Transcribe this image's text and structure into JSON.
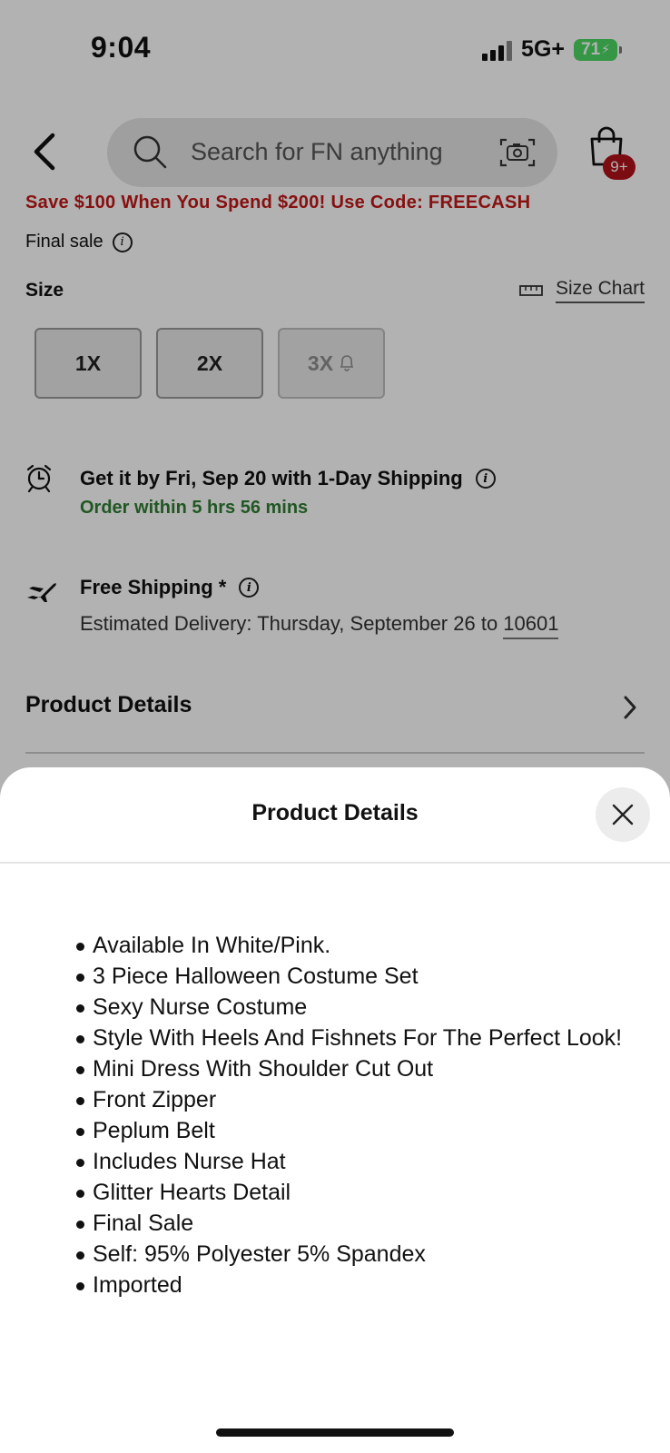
{
  "status_bar": {
    "time": "9:04",
    "network": "5G+",
    "battery": "71"
  },
  "header": {
    "search_placeholder": "Search for FN anything",
    "cart_badge": "9+"
  },
  "product": {
    "promo": "Save $100 When You Spend $200! Use Code: FREECASH",
    "final_sale_label": "Final sale",
    "size_label": "Size",
    "size_chart_label": "Size Chart",
    "sizes": [
      {
        "label": "1X",
        "available": true
      },
      {
        "label": "2X",
        "available": true
      },
      {
        "label": "3X",
        "available": false
      }
    ]
  },
  "shipping": {
    "express_title": "Get it by Fri, Sep 20 with 1-Day Shipping",
    "express_sub": "Order within 5 hrs 56 mins",
    "free_title": "Free Shipping *",
    "free_sub_prefix": "Estimated Delivery: Thursday, September 26 to ",
    "zip": "10601"
  },
  "details_row_label": "Product Details",
  "sheet": {
    "title": "Product Details",
    "bullets": [
      "Available In White/Pink.",
      "3 Piece Halloween Costume Set",
      "Sexy Nurse Costume",
      "Style With Heels And Fishnets For The Perfect Look!",
      "Mini Dress With Shoulder Cut Out",
      "Front Zipper",
      "Peplum Belt",
      "Includes Nurse Hat",
      "Glitter Hearts Detail",
      "Final Sale",
      "Self: 95% Polyester 5% Spandex",
      "Imported"
    ]
  },
  "colors": {
    "promo_red": "#c21818",
    "success_green": "#2e7d32",
    "badge_red": "#b0121b",
    "battery_green": "#4cd964"
  }
}
